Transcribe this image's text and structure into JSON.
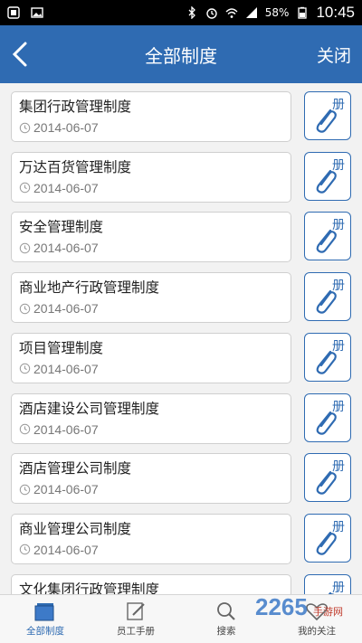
{
  "status_bar": {
    "battery": "58%",
    "time": "10:45"
  },
  "nav": {
    "title": "全部制度",
    "close_label": "关闭"
  },
  "attachment_label": "册",
  "items": [
    {
      "title": "集团行政管理制度",
      "date": "2014-06-07"
    },
    {
      "title": "万达百货管理制度",
      "date": "2014-06-07"
    },
    {
      "title": "安全管理制度",
      "date": "2014-06-07"
    },
    {
      "title": "商业地产行政管理制度",
      "date": "2014-06-07"
    },
    {
      "title": "项目管理制度",
      "date": "2014-06-07"
    },
    {
      "title": "酒店建设公司管理制度",
      "date": "2014-06-07"
    },
    {
      "title": "酒店管理公司制度",
      "date": "2014-06-07"
    },
    {
      "title": "商业管理公司制度",
      "date": "2014-06-07"
    },
    {
      "title": "文化集团行政管理制度",
      "date": ""
    }
  ],
  "tabs": [
    {
      "label": "全部制度",
      "icon": "book-icon",
      "active": true
    },
    {
      "label": "员工手册",
      "icon": "pen-icon",
      "active": false
    },
    {
      "label": "搜索",
      "icon": "search-icon",
      "active": false
    },
    {
      "label": "我的关注",
      "icon": "heart-icon",
      "active": false
    }
  ],
  "watermark": {
    "text": "2265",
    "sub": "手游网"
  },
  "colors": {
    "accent": "#2f6bb2",
    "statusbar": "#000000"
  }
}
